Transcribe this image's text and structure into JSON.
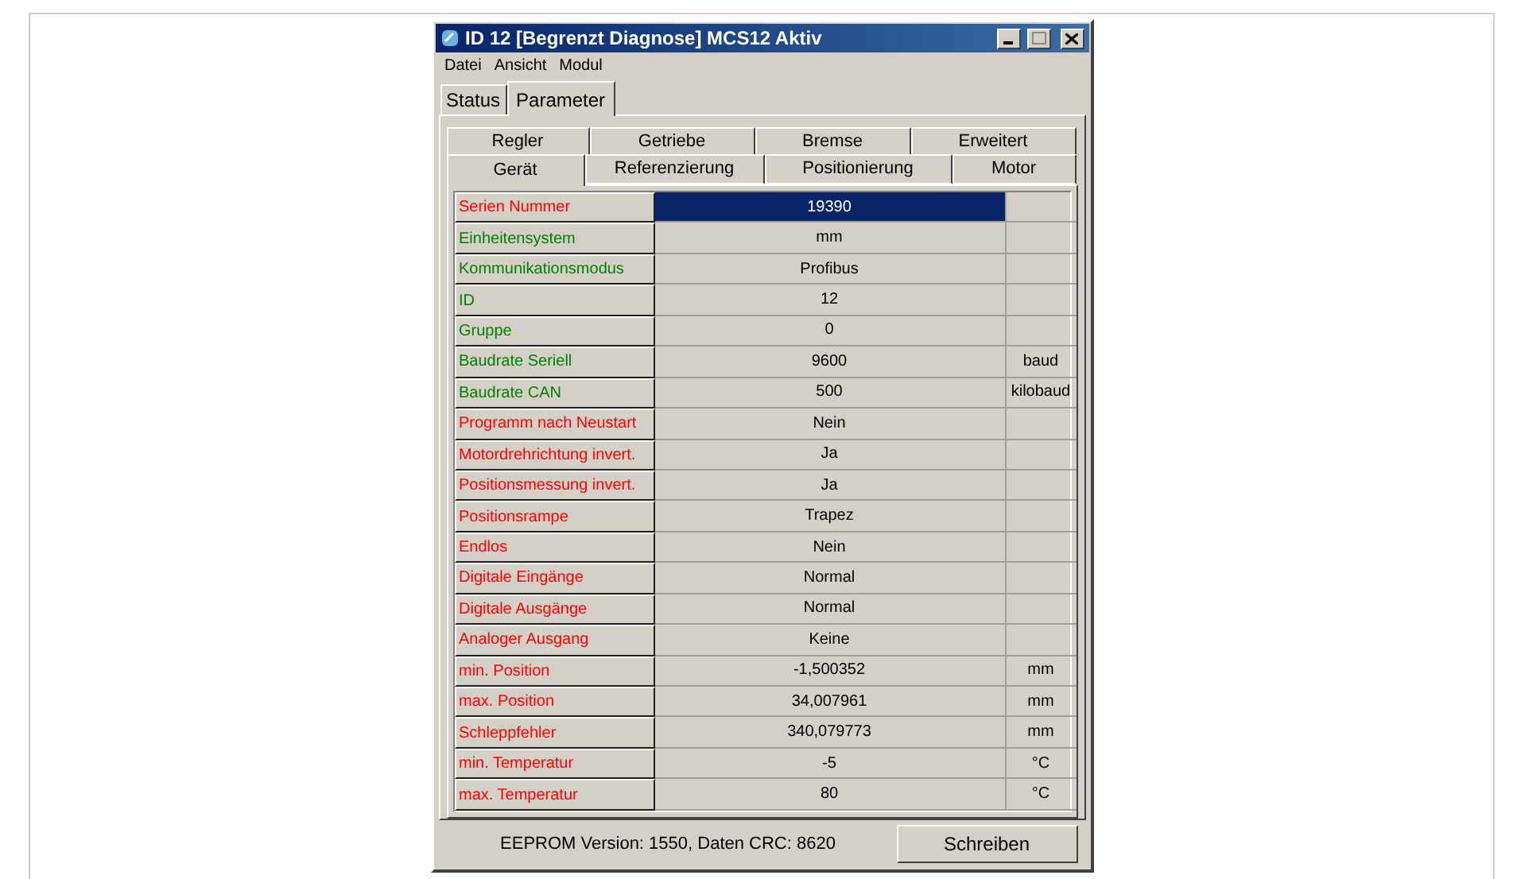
{
  "window": {
    "title": "ID 12 [Begrenzt Diagnose] MCS12 Aktiv"
  },
  "menu": [
    "Datei",
    "Ansicht",
    "Modul"
  ],
  "tabs": [
    {
      "label": "Status",
      "selected": false
    },
    {
      "label": "Parameter",
      "selected": true
    }
  ],
  "subtabs_back": [
    {
      "label": "Regler",
      "selected": false
    },
    {
      "label": "Getriebe",
      "selected": false
    },
    {
      "label": "Bremse",
      "selected": false
    },
    {
      "label": "Erweitert",
      "selected": false
    }
  ],
  "subtabs_front": [
    {
      "label": "Gerät",
      "selected": true
    },
    {
      "label": "Referenzierung",
      "selected": false
    },
    {
      "label": "Positionierung",
      "selected": false
    },
    {
      "label": "Motor",
      "selected": false
    }
  ],
  "rows": [
    {
      "name": "Serien Nummer",
      "value": "19390",
      "unit": "",
      "color": "#ff0000",
      "selected": true
    },
    {
      "name": "Einheitensystem",
      "value": "mm",
      "unit": "",
      "color": "#008000",
      "selected": false
    },
    {
      "name": "Kommunikationsmodus",
      "value": "Profibus",
      "unit": "",
      "color": "#008000",
      "selected": false
    },
    {
      "name": "ID",
      "value": "12",
      "unit": "",
      "color": "#008000",
      "selected": false
    },
    {
      "name": "Gruppe",
      "value": "0",
      "unit": "",
      "color": "#008000",
      "selected": false
    },
    {
      "name": "Baudrate Seriell",
      "value": "9600",
      "unit": "baud",
      "color": "#008000",
      "selected": false
    },
    {
      "name": "Baudrate CAN",
      "value": "500",
      "unit": "kilobaud",
      "color": "#008000",
      "selected": false
    },
    {
      "name": "Programm nach Neustart",
      "value": "Nein",
      "unit": "",
      "color": "#ff0000",
      "selected": false
    },
    {
      "name": "Motordrehrichtung invert.",
      "value": "Ja",
      "unit": "",
      "color": "#ff0000",
      "selected": false
    },
    {
      "name": "Positionsmessung invert.",
      "value": "Ja",
      "unit": "",
      "color": "#ff0000",
      "selected": false
    },
    {
      "name": "Positionsrampe",
      "value": "Trapez",
      "unit": "",
      "color": "#ff0000",
      "selected": false
    },
    {
      "name": "Endlos",
      "value": "Nein",
      "unit": "",
      "color": "#ff0000",
      "selected": false
    },
    {
      "name": "Digitale Eingänge",
      "value": "Normal",
      "unit": "",
      "color": "#ff0000",
      "selected": false
    },
    {
      "name": "Digitale Ausgänge",
      "value": "Normal",
      "unit": "",
      "color": "#ff0000",
      "selected": false
    },
    {
      "name": "Analoger Ausgang",
      "value": "Keine",
      "unit": "",
      "color": "#ff0000",
      "selected": false
    },
    {
      "name": "min. Position",
      "value": "-1,500352",
      "unit": "mm",
      "color": "#ff0000",
      "selected": false
    },
    {
      "name": "max. Position",
      "value": "34,007961",
      "unit": "mm",
      "color": "#ff0000",
      "selected": false
    },
    {
      "name": "Schleppfehler",
      "value": "340,079773",
      "unit": "mm",
      "color": "#ff0000",
      "selected": false
    },
    {
      "name": "min. Temperatur",
      "value": "-5",
      "unit": "°C",
      "color": "#ff0000",
      "selected": false
    },
    {
      "name": "max. Temperatur",
      "value": "80",
      "unit": "°C",
      "color": "#ff0000",
      "selected": false
    }
  ],
  "status_bar": {
    "text": "EEPROM Version: 1550, Daten CRC: 8620",
    "button": "Schreiben"
  }
}
